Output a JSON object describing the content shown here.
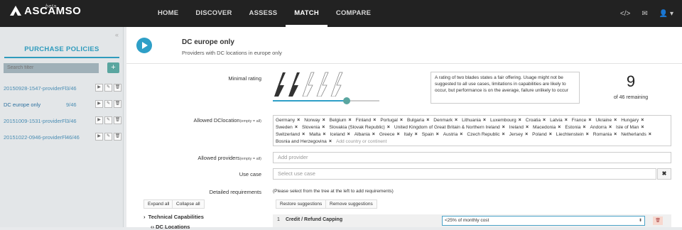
{
  "app": {
    "name": "ASCAMSO",
    "badge": "beta"
  },
  "nav": {
    "items": [
      "HOME",
      "DISCOVER",
      "ASSESS",
      "MATCH",
      "COMPARE"
    ],
    "active": "MATCH"
  },
  "topbar_icons": {
    "code": "</>",
    "mail": "✉",
    "user": "👤 ▾"
  },
  "sidebar": {
    "collapse": "«",
    "title": "PURCHASE POLICIES",
    "filter_placeholder": "Search filter",
    "add_label": "+",
    "policies": [
      {
        "name": "20150928-1547-providerFl",
        "count": "3/46",
        "active": false
      },
      {
        "name": "DC europe only",
        "count": "9/46",
        "active": true
      },
      {
        "name": "20151009-1531-providerFl",
        "count": "3/46",
        "active": false
      },
      {
        "name": "20151022-0946-providerFl",
        "count": "46/46",
        "active": false
      }
    ],
    "row_buttons": [
      "▶",
      "✎",
      "🗑"
    ]
  },
  "policy": {
    "title": "DC europe only",
    "subtitle": "Providers with DC locations in europe only"
  },
  "rating": {
    "label": "Minimal rating",
    "value_fraction": 0.4,
    "note": "A rating of two blades states a fair offering. Usage might not be suggested to all use cases, limitations in capabilities are likely to occur, but performance is on the average, failure unlikely to occur",
    "remaining_count": "9",
    "remaining_label": "of 46 remaining"
  },
  "dclocation": {
    "label": "Allowed DClocation",
    "hint": "(empty = all)",
    "placeholder": "Add country or continent",
    "countries": [
      "Germany",
      "Norway",
      "Belgium",
      "Finland",
      "Portugal",
      "Bulgaria",
      "Denmark",
      "Lithuania",
      "Luxembourg",
      "Croatia",
      "Latvia",
      "France",
      "Ukraine",
      "Hungary",
      "Sweden",
      "Slovenia",
      "Slovakia (Slovak Republic)",
      "United Kingdom of Great Britain & Northern Ireland",
      "Ireland",
      "Macedonia",
      "Estonia",
      "Andorra",
      "Isle of Man",
      "Switzerland",
      "Malta",
      "Iceland",
      "Albania",
      "Greece",
      "Italy",
      "Spain",
      "Austria",
      "Czech Republic",
      "Jersey",
      "Poland",
      "Liechtenstein",
      "Romania",
      "Netherlands",
      "Bosnia and Herzegovina"
    ]
  },
  "providers": {
    "label": "Allowed providers",
    "hint": "(empty = all)",
    "placeholder": "Add provider"
  },
  "usecase": {
    "label": "Use case",
    "placeholder": "Select use case",
    "clear": "✖"
  },
  "requirements": {
    "label": "Detailed requirements",
    "hint": "(Please select from the tree at the left to add requirements)",
    "expand_all": "Expand all",
    "collapse_all": "Collapse all",
    "restore": "Restore suggestions",
    "remove": "Remove suggestions",
    "tree": [
      {
        "label": "Technical Capabilities",
        "marker": "›"
      },
      {
        "label": "DC Locations",
        "marker": "‹›"
      }
    ],
    "rows": [
      {
        "num": "1",
        "name": "Credit / Refund Capping",
        "value": "<25% of monthly cost"
      }
    ]
  }
}
